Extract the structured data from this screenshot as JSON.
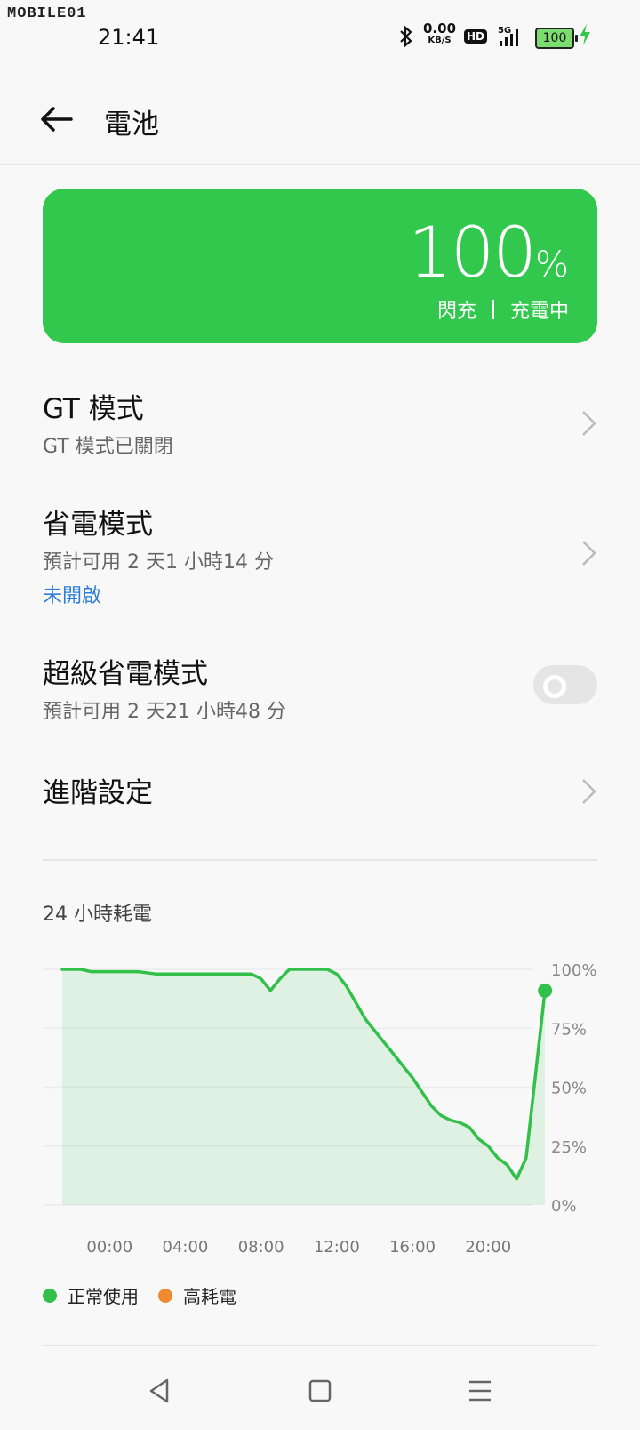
{
  "status_bar": {
    "watermark": "MOBILE01",
    "time": "21:41",
    "net_speed_value": "0.00",
    "net_speed_unit": "KB/S",
    "hd_badge": "HD",
    "network": "5G",
    "battery_level": "100"
  },
  "header": {
    "title": "電池"
  },
  "battery_card": {
    "percent": "100",
    "percent_sign": "%",
    "charge_type": "閃充",
    "charge_status": "充電中",
    "color": "#32c84e"
  },
  "settings": {
    "gt_mode": {
      "title": "GT 模式",
      "subtitle": "GT 模式已關閉"
    },
    "power_saving": {
      "title": "省電模式",
      "subtitle": "預計可用 2 天1 小時14 分",
      "status": "未開啟"
    },
    "super_power_saving": {
      "title": "超級省電模式",
      "subtitle": "預計可用 2 天21 小時48 分",
      "enabled": false
    },
    "advanced": {
      "title": "進階設定"
    }
  },
  "chart_section": {
    "title": "24 小時耗電"
  },
  "chart_data": {
    "type": "area",
    "title": "24 小時耗電",
    "x_ticks": [
      "00:00",
      "04:00",
      "08:00",
      "12:00",
      "16:00",
      "20:00"
    ],
    "y_ticks": [
      "100%",
      "75%",
      "50%",
      "25%",
      "0%"
    ],
    "ylim": [
      0,
      100
    ],
    "xlim": [
      -2.5,
      22
    ],
    "series": [
      {
        "name": "正常使用",
        "color": "#33c04a",
        "points": [
          [
            -2.5,
            100
          ],
          [
            -1.5,
            100
          ],
          [
            -1,
            99
          ],
          [
            1.5,
            99
          ],
          [
            2.5,
            98
          ],
          [
            7.5,
            98
          ],
          [
            8,
            96
          ],
          [
            8.5,
            91
          ],
          [
            9,
            96
          ],
          [
            9.5,
            100
          ],
          [
            11.5,
            100
          ],
          [
            12,
            98
          ],
          [
            12.5,
            93
          ],
          [
            13,
            86
          ],
          [
            13.5,
            79
          ],
          [
            14,
            74
          ],
          [
            14.5,
            69
          ],
          [
            15,
            64
          ],
          [
            15.5,
            59
          ],
          [
            16,
            54
          ],
          [
            16.5,
            48
          ],
          [
            17,
            42
          ],
          [
            17.5,
            38
          ],
          [
            18,
            36
          ],
          [
            18.5,
            35
          ],
          [
            19,
            33
          ],
          [
            19.5,
            28
          ],
          [
            20,
            25
          ],
          [
            20.5,
            20
          ],
          [
            21,
            17
          ],
          [
            21.5,
            11
          ],
          [
            22,
            20
          ],
          [
            23,
            91
          ]
        ]
      }
    ],
    "legend": [
      {
        "label": "正常使用",
        "color": "#33c04a"
      },
      {
        "label": "高耗電",
        "color": "#f08a2e"
      }
    ],
    "grid": true
  },
  "nav_bar": {
    "back": "back-nav-icon",
    "home": "home-nav-icon",
    "menu": "menu-nav-icon"
  }
}
